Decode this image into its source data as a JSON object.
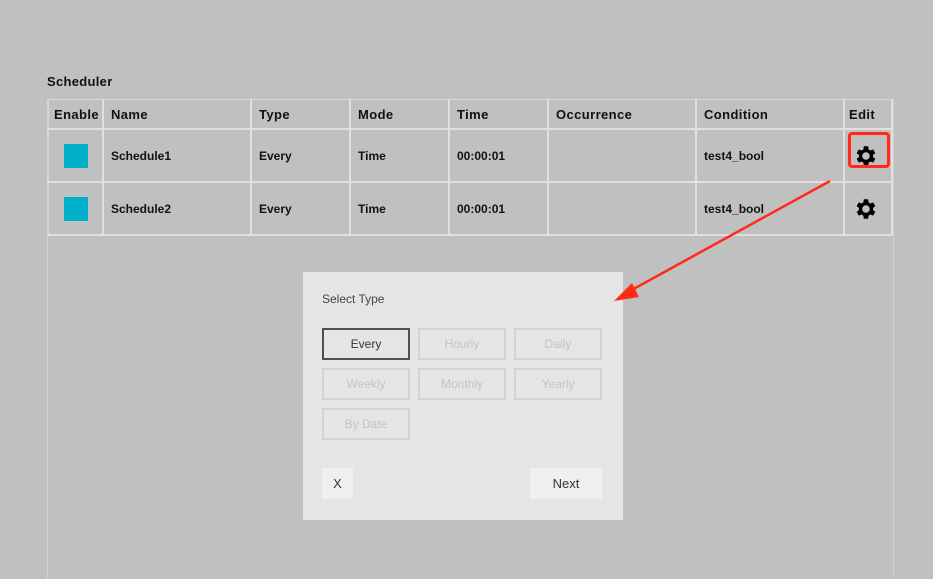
{
  "page": {
    "title": "Scheduler"
  },
  "table": {
    "columns": [
      "Enable",
      "Name",
      "Type",
      "Mode",
      "Time",
      "Occurrence",
      "Condition",
      "Edit"
    ],
    "rows": [
      {
        "enabled": true,
        "name": "Schedule1",
        "type": "Every",
        "mode": "Time",
        "time": "00:00:01",
        "occurrence": "",
        "condition": "test4_bool",
        "edit_icon": "gear-icon",
        "highlighted": true
      },
      {
        "enabled": true,
        "name": "Schedule2",
        "type": "Every",
        "mode": "Time",
        "time": "00:00:01",
        "occurrence": "",
        "condition": "test4_bool",
        "edit_icon": "gear-icon",
        "highlighted": false
      }
    ]
  },
  "dialog": {
    "title": "Select Type",
    "options": [
      {
        "label": "Every",
        "selected": true
      },
      {
        "label": "Hourly",
        "selected": false
      },
      {
        "label": "Daily",
        "selected": false
      },
      {
        "label": "Weekly",
        "selected": false
      },
      {
        "label": "Monthly",
        "selected": false
      },
      {
        "label": "Yearly",
        "selected": false
      },
      {
        "label": "By Date",
        "selected": false
      }
    ],
    "close_label": "X",
    "next_label": "Next"
  },
  "colors": {
    "background": "#c0c0c0",
    "enable_toggle": "#00b0c8",
    "annotation": "#ff2a1a",
    "dialog_bg": "#e5e5e5"
  }
}
